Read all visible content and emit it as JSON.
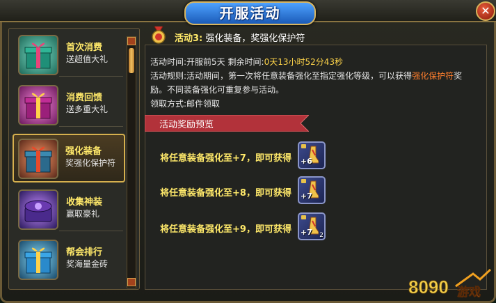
{
  "window": {
    "title": "开服活动",
    "close_label": "✕"
  },
  "activities": [
    {
      "name": "首次消费",
      "desc": "送超值大礼",
      "gift_color": "#2aa88a",
      "ribbon": "#e8447a"
    },
    {
      "name": "消费回馈",
      "desc": "送多重大礼",
      "gift_color": "#b02a8a",
      "ribbon": "#ffd24a"
    },
    {
      "name": "强化装备",
      "desc": "奖强化保护符",
      "gift_color": "#2b7a9c",
      "ribbon": "#e84a2a",
      "selected": true
    },
    {
      "name": "收集神装",
      "desc": "赢取豪礼",
      "gift_color": "#4a2a8c",
      "ribbon": "#c9a0ff"
    },
    {
      "name": "帮会排行",
      "desc": "奖海量金砖",
      "gift_color": "#2a8acb",
      "ribbon": "#ffd24a"
    }
  ],
  "detail": {
    "heading_prefix": "活动3:",
    "heading_text": "强化装备，奖强化保护符",
    "time_label": "活动时间:",
    "time_value": "开服前5天",
    "remaining_label": "剩余时间:",
    "remaining_value": "0天13小时52分43秒",
    "rule_label": "活动规则:",
    "rule_text_1": "活动期间，第一次将任意装备强化至指定强化等级，可以获得",
    "rule_highlight": "强化保护符",
    "rule_text_2": "奖",
    "rule_text_3": "励。不同装备强化可重复参与活动。",
    "claim_label": "领取方式:",
    "claim_value": "邮件领取",
    "preview_banner": "活动奖励预览"
  },
  "rewards": [
    {
      "text": "将任意装备强化至+7，即可获得",
      "plus": "+6",
      "count": ""
    },
    {
      "text": "将任意装备强化至+8，即可获得",
      "plus": "+7",
      "count": ""
    },
    {
      "text": "将任意装备强化至+9，即可获得",
      "plus": "+7",
      "count": "2"
    }
  ],
  "logo": {
    "number": "8090",
    "brand": "游戏"
  }
}
